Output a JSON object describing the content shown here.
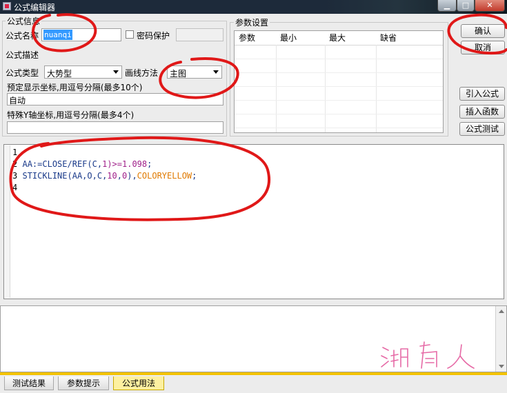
{
  "window": {
    "title": "公式编辑器"
  },
  "info": {
    "legend": "公式信息",
    "name_label": "公式名称",
    "name_value": "nuanqi",
    "password_label": "密码保护",
    "desc_label": "公式描述",
    "type_label": "公式类型",
    "type_value": "大势型",
    "draw_label": "画线方法",
    "draw_value": "主图",
    "coords_label": "预定显示坐标,用逗号分隔(最多10个)",
    "coords_value": "自动",
    "yaxis_label": "特殊Y轴坐标,用逗号分隔(最多4个)",
    "yaxis_value": ""
  },
  "params": {
    "legend": "参数设置",
    "columns": [
      "参数",
      "最小",
      "最大",
      "缺省"
    ]
  },
  "buttons": {
    "confirm": "确认",
    "cancel": "取消",
    "import": "引入公式",
    "insert_func": "插入函数",
    "test": "公式测试"
  },
  "code": {
    "line1": "1",
    "line2_num": "2",
    "line2_a": "AA:=CLOSE/REF",
    "line2_b": "(C,",
    "line2_c": "1",
    "line2_d": ")>=",
    "line2_e": "1.098",
    "line2_f": ";",
    "line3_num": "3",
    "line3_a": "STICKLINE(AA,O,C,",
    "line3_b": "10",
    "line3_c": ",",
    "line3_d": "0",
    "line3_e": "),",
    "line3_f": "COLORYELLOW",
    "line3_g": ";",
    "line4": "4"
  },
  "tabs": [
    "测试结果",
    "参数提示",
    "公式用法"
  ],
  "colors": {
    "ink": "#e01818",
    "accent_tab": "#f2c200"
  }
}
